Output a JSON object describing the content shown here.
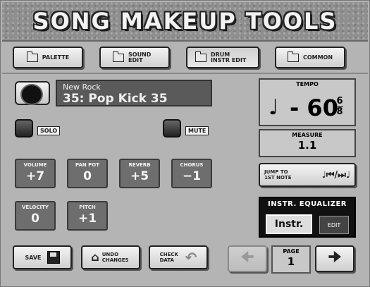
{
  "title": "SONG MAKEUP TOOLS",
  "tabs": [
    {
      "label": "PALETTE"
    },
    {
      "label": "SOUND EDIT"
    },
    {
      "label": "DRUM INSTR EDIT"
    },
    {
      "label": "COMMON"
    }
  ],
  "instrument": {
    "line1": "New Rock",
    "line2": "35: Pop Kick 35"
  },
  "solo_label": "SOLO",
  "mute_label": "MUTE",
  "params": [
    {
      "label": "VOLUME",
      "value": "+7"
    },
    {
      "label": "PAN POT",
      "value": "0"
    },
    {
      "label": "REVERB",
      "value": "+5"
    },
    {
      "label": "CHORUS",
      "value": "−1"
    },
    {
      "label": "VELOCITY",
      "value": "0"
    },
    {
      "label": "PITCH",
      "value": "+1"
    }
  ],
  "tempo": {
    "label": "TEMPO",
    "note": "♩",
    "value": "- 60",
    "time_sig_top": "6",
    "time_sig_bottom": "8"
  },
  "measure": {
    "label": "MEASURE",
    "value": "1.1"
  },
  "jump": {
    "label": "JUMP TO 1ST NOTE",
    "icon_text": "♩⏮/⏭♩"
  },
  "equalizer": {
    "label": "INSTR. EQUALIZER",
    "instr": "Instr.",
    "edit": "EDIT"
  },
  "bottom": {
    "save": "SAVE",
    "undo": "UNDO CHANGES",
    "check": "CHECK DATA"
  },
  "page": {
    "label": "PAGE",
    "value": "1"
  }
}
